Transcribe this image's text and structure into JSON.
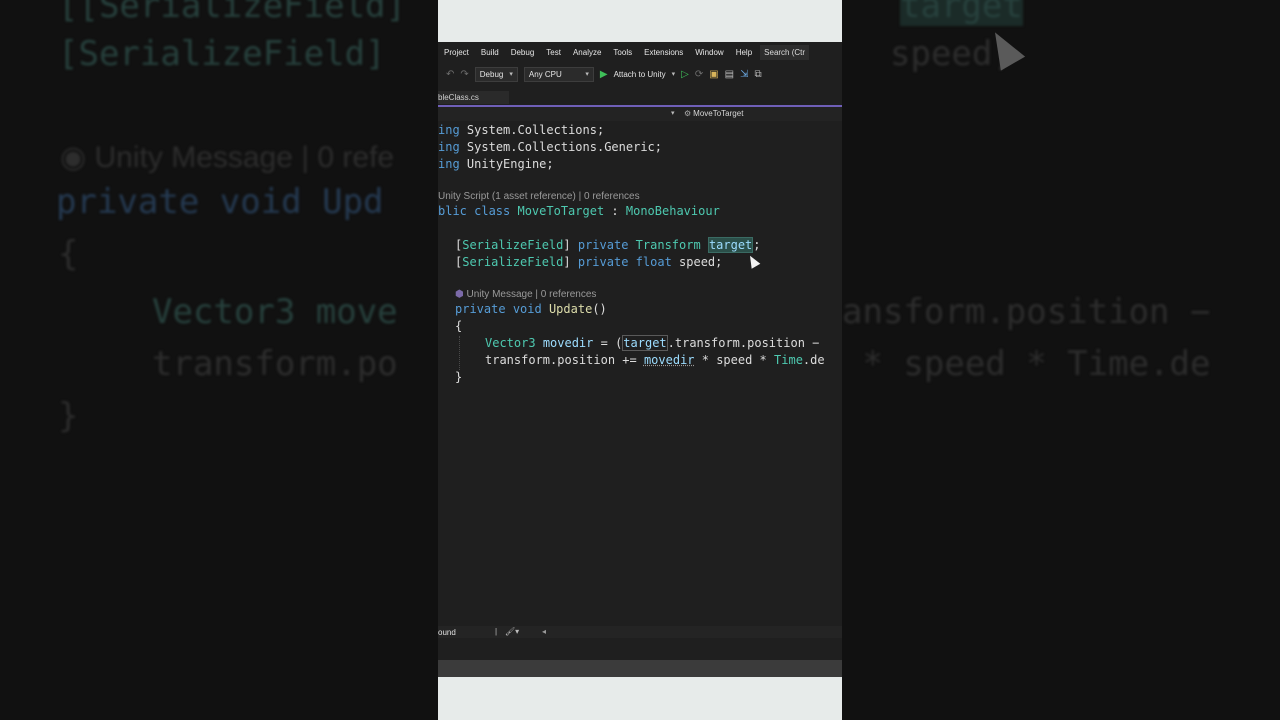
{
  "menu": {
    "items": [
      "Project",
      "Build",
      "Debug",
      "Test",
      "Analyze",
      "Tools",
      "Extensions",
      "Window",
      "Help"
    ],
    "search_label": "Search (Ctr"
  },
  "toolbar": {
    "config": "Debug",
    "platform": "Any CPU",
    "attach_label": "Attach to Unity"
  },
  "tab": {
    "filename": "bleClass.cs"
  },
  "navbar": {
    "member": "MoveToTarget"
  },
  "code": {
    "using1_kw": "ing",
    "using1_ns": "System.Collections;",
    "using2_kw": "ing",
    "using2_ns": "System.Collections.Generic;",
    "using3_kw": "ing",
    "using3_ns": "UnityEngine;",
    "lens_class": "Unity Script (1 asset reference) | 0 references",
    "class_kw": "blic class ",
    "class_name": "MoveToTarget",
    "class_colon": " : ",
    "class_base": "MonoBehaviour",
    "attr": "SerializeField",
    "private_kw": "private",
    "transform_type": "Transform",
    "target_name": "target",
    "float_kw": "float",
    "speed_name": "speed;",
    "lens_method": "Unity Message | 0 references",
    "void_kw": "void",
    "update_name": "Update",
    "parens": "()",
    "open_brace": "{",
    "close_brace": "}",
    "vector_type": "Vector3",
    "movedir": "movedir",
    "line1_tail": ".transform.position − ",
    "line2_a": "transform.position += ",
    "line2_b": " * speed * ",
    "time": "Time",
    "line2_c": ".de"
  },
  "status": {
    "found": "ound"
  },
  "background_zoom": {
    "l1": "[SerializeField]",
    "l1b": "speed;",
    "l0": "target",
    "lens": "Unity Message | 0 refe",
    "sig": "private void Upd",
    "brace_open": "{",
    "vec": "Vector3 move",
    "vec_tail": "ansform.position −",
    "tp": "transform.po",
    "tp_tail": " * speed * Time.de",
    "brace_close": "}"
  }
}
